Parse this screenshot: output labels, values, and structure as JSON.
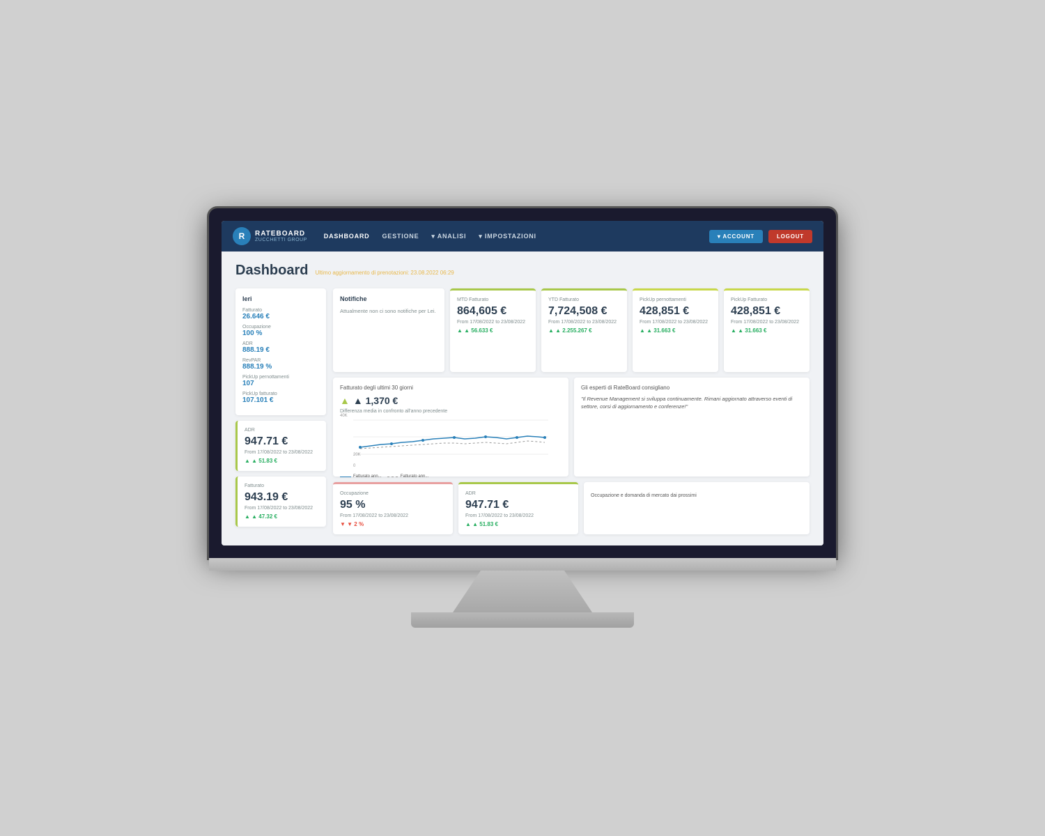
{
  "monitor": {
    "navbar": {
      "logo_main": "RATEBOARD",
      "logo_sub": "ZUCCHETTI GROUP",
      "nav_items": [
        {
          "label": "DASHBOARD",
          "active": true,
          "has_dropdown": false
        },
        {
          "label": "GESTIONE",
          "active": false,
          "has_dropdown": false
        },
        {
          "label": "ANALISI",
          "active": false,
          "has_dropdown": true
        },
        {
          "label": "IMPOSTAZIONI",
          "active": false,
          "has_dropdown": true
        }
      ],
      "account_label": "▾ ACCOUNT",
      "logout_label": "LOGOUT"
    },
    "page": {
      "title": "Dashboard",
      "last_update_label": "Ultimo aggiornamento di prenotazioni: 23.08.2022 06:29"
    },
    "ieri": {
      "title": "Ieri",
      "fatturato_label": "Fatturato",
      "fatturato_value": "26.646 €",
      "occupazione_label": "Occupazione",
      "occupazione_value": "100 %",
      "adr_label": "ADR",
      "adr_value": "888.19 €",
      "revpar_label": "RevPAR",
      "revpar_value": "888.19 %",
      "pickup_pernottamenti_label": "PickUp pernottamenti",
      "pickup_pernottamenti_value": "107",
      "pickup_fatturato_label": "PickUp fatturato",
      "pickup_fatturato_value": "107.101 €"
    },
    "notifiche": {
      "title": "Notifiche",
      "text": "Attualmente non ci sono notifiche per Lei."
    },
    "metrics_top": [
      {
        "label": "MTD Fatturato",
        "value": "864,605 €",
        "range": "From 17/08/2022 to 23/08/2022",
        "delta": "▲ 56.633 €",
        "delta_up": true,
        "border_color": "#a8c84a"
      },
      {
        "label": "YTD Fatturato",
        "value": "7,724,508 €",
        "range": "From 17/08/2022 to 23/08/2022",
        "delta": "▲ 2.255.267 €",
        "delta_up": true,
        "border_color": "#a8c84a"
      },
      {
        "label": "PickUp pernottamenti",
        "value": "428,851 €",
        "range": "From 17/08/2022 to 23/08/2022",
        "delta": "▲ 31.663 €",
        "delta_up": true,
        "border_color": "#c8d84a"
      },
      {
        "label": "PickUp Fatturato",
        "value": "428,851 €",
        "range": "From 17/08/2022 to 23/08/2022",
        "delta": "▲ 31.663 €",
        "delta_up": true,
        "border_color": "#c8d84a"
      }
    ],
    "chart_30days": {
      "title": "Fatturato degli ultimi 30 giorni",
      "value": "▲ 1,370 €",
      "subtitle": "Differenza media in confronto all'anno precedente",
      "y_max": "40K",
      "y_mid": "20K",
      "y_min": "0"
    },
    "experts": {
      "title": "Gli esperti di RateBoard consigliano",
      "quote": "\"Il Revenue Management si sviluppa continuamente. Rimani aggiornato attraverso eventi di settore, corsi di aggiornamento e conferenze!\""
    },
    "bottom_metrics": [
      {
        "label": "ADR",
        "value": "947.71 €",
        "range": "From 17/08/2022 to 23/08/2022",
        "delta": "▲ 51.83 €",
        "delta_up": true,
        "border_color": "#a8c84a"
      },
      {
        "label": "Fatturato",
        "value": "943.19 €",
        "range": "From 17/08/2022 to 23/08/2022",
        "delta": "▲ 47.32 €",
        "delta_up": true,
        "border_color": "#a8c84a"
      }
    ],
    "occupazione_card": {
      "label": "Occupazione",
      "value": "95 %",
      "range": "From 17/08/2022 to 23/08/2022",
      "delta": "▼ 2 %",
      "delta_up": false,
      "border_color": "#e8a0a0"
    },
    "adr_bottom": {
      "label": "ADR",
      "value": "947.71 €",
      "range": "From 17/08/2022 to 23/08/2022",
      "delta": "▲ 51.83 €",
      "delta_up": true,
      "border_color": "#a8c84a"
    },
    "footer_note": "Occupazione e domanda di mercato dai prossimi"
  }
}
